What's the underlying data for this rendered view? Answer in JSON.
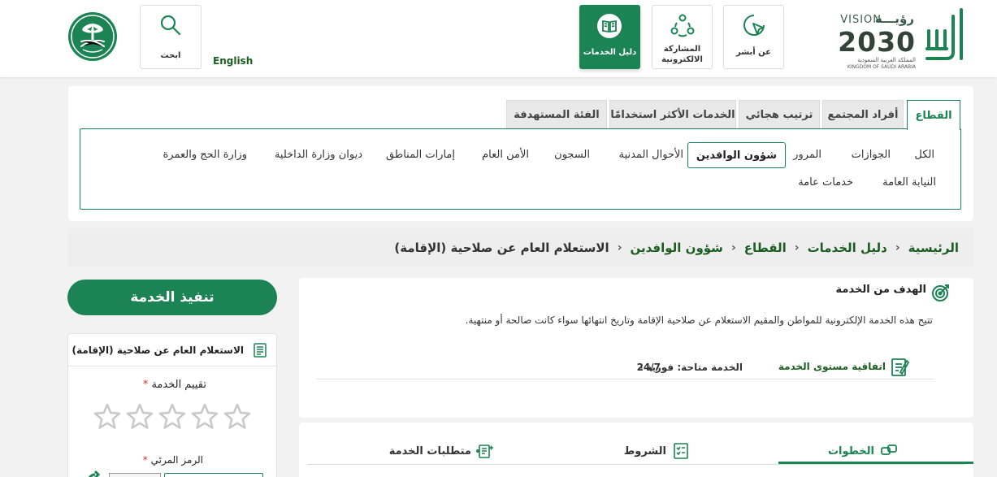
{
  "header": {
    "nav": {
      "about": "عن أبشر",
      "eparticipation": "المشاركة الالكترونية",
      "services_guide": "دليل الخدمات"
    },
    "search_label": "ابحث",
    "lang_link": "English",
    "vision": {
      "arabic": "رؤيـــة",
      "english": "VISION",
      "year": "2030",
      "kingdom_ar": "المملكة العربية السعودية",
      "kingdom_en": "KINGDOM OF SAUDI ARABIA"
    },
    "colors": {
      "brand": "#1b8354"
    }
  },
  "categories": {
    "tabs": [
      "القطاع",
      "أفراد المجتمع",
      "ترتيب هجائي",
      "الخدمات الأكثر استخدامًا",
      "الفئة المستهدفة"
    ],
    "active_tab": "القطاع",
    "items_row1": [
      "الكل",
      "الجوازات",
      "المرور",
      "شؤون الوافدين",
      "الأحوال المدنية",
      "السجون",
      "الأمن العام",
      "إمارات المناطق",
      "ديوان وزارة الداخلية",
      "وزارة الحج والعمرة"
    ],
    "items_row2": [
      "النيابة العامة",
      "خدمات عامة"
    ],
    "selected_item": "شؤون الوافدين"
  },
  "breadcrumb": {
    "items": [
      "الرئيسية",
      "دليل الخدمات",
      "القطاع",
      "شؤون الوافدين",
      "الاستعلام العام عن صلاحية (الإقامة)"
    ]
  },
  "service": {
    "goal_title": "الهدف من الخدمة",
    "goal_description": "تتيح هذه الخدمة الإلكترونية للمواطن والمقيم الاستعلام عن صلاحية الإقامة وتاريخ انتهائها سواء كانت صالحة أو منتهية.",
    "sla_label": "اتفاقية مستوى الخدمة",
    "availability_label": "الخدمة متاحة: فورية -",
    "availability_value": "24/7",
    "tabs": {
      "steps": "الخطوات",
      "conditions": "الشروط",
      "requirements": "متطلبات الخدمة"
    }
  },
  "sidebar": {
    "execute_button": "تنفيذ الخدمة",
    "card_title": "الاستعلام العام عن صلاحية (الإقامة)",
    "rating_label": "تقييم الخدمة",
    "rating_required": "*",
    "rating_value": 0,
    "rating_max": 5,
    "captcha_label": "الرمز المرئي",
    "captcha_required": "*"
  }
}
